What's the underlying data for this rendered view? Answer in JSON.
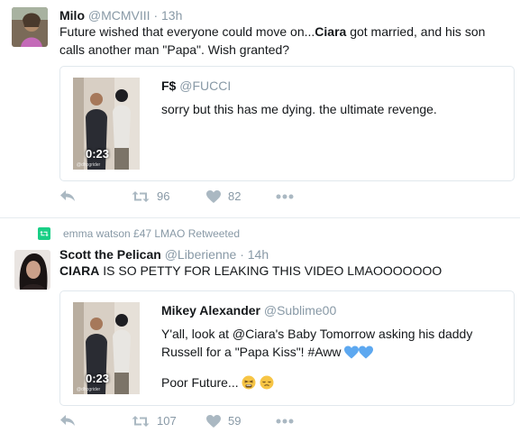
{
  "tweet1": {
    "name": "Milo",
    "handle": "@MCMVIII",
    "dot": "·",
    "time": "13h",
    "text_a": "Future wished that everyone could move on...",
    "text_bold": "Ciara",
    "text_b": " got married, and his son calls another man \"Papa\". Wish granted?",
    "quote": {
      "name": "F$",
      "handle": "@FUCCI",
      "text": "sorry but this has me dying. the ultimate revenge.",
      "duration": "0:23",
      "watermark": "@dhpgrider"
    },
    "retweets": "96",
    "likes": "82"
  },
  "retweet_note": "emma watson £47 LMAO Retweeted",
  "tweet2": {
    "name": "Scott the Pelican",
    "handle": "@Liberienne",
    "dot": "·",
    "time": "14h",
    "text_bold": "CIARA",
    "text_rest": " IS SO PETTY FOR LEAKING THIS VIDEO LMAOOOOOOO",
    "quote": {
      "name": "Mikey Alexander",
      "handle": "@Sublime00",
      "text_line1": "Y'all, look at @Ciara's Baby Tomorrow asking his daddy",
      "text_line2": "Russell for a \"Papa Kiss\"! #Aww",
      "text_line3": "Poor Future...",
      "duration": "0:23",
      "watermark": "@dhpgrider"
    },
    "retweets": "107",
    "likes": "59"
  },
  "icons": [
    "reply-icon",
    "retweet-icon",
    "heart-icon",
    "more-icon",
    "retweet-badge-icon",
    "blue-heart-icon",
    "tired-face-emoji",
    "relieved-face-emoji"
  ],
  "colors": {
    "muted": "#8899a6",
    "retweet_green": "#19cf86",
    "heart_blue": "#5da8f0",
    "border": "#e1e8ed"
  }
}
